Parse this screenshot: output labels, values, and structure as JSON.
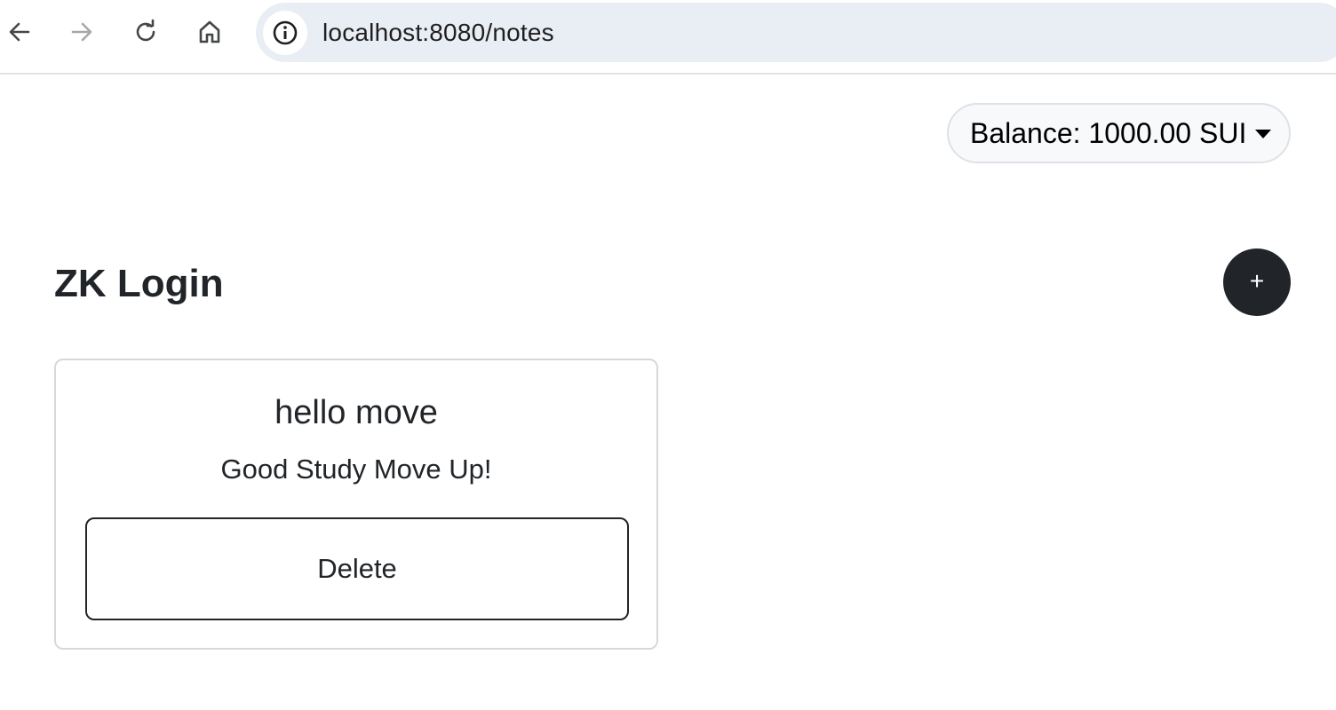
{
  "browser": {
    "url": "localhost:8080/notes",
    "icons": {
      "back": "arrow-left-icon",
      "forward": "arrow-right-icon",
      "reload": "reload-icon",
      "home": "home-icon",
      "site_info": "info-icon"
    }
  },
  "header": {
    "balance_label": "Balance: 1000.00 SUI"
  },
  "main": {
    "title": "ZK Login",
    "add_button_label": "+"
  },
  "notes": [
    {
      "title": "hello move",
      "body": "Good Study Move Up!",
      "delete_label": "Delete"
    }
  ],
  "colors": {
    "dark": "#212529",
    "address_bar_bg": "#e9edf4",
    "dropdown_bg": "#f8f9fa",
    "border": "#dee2e6"
  }
}
